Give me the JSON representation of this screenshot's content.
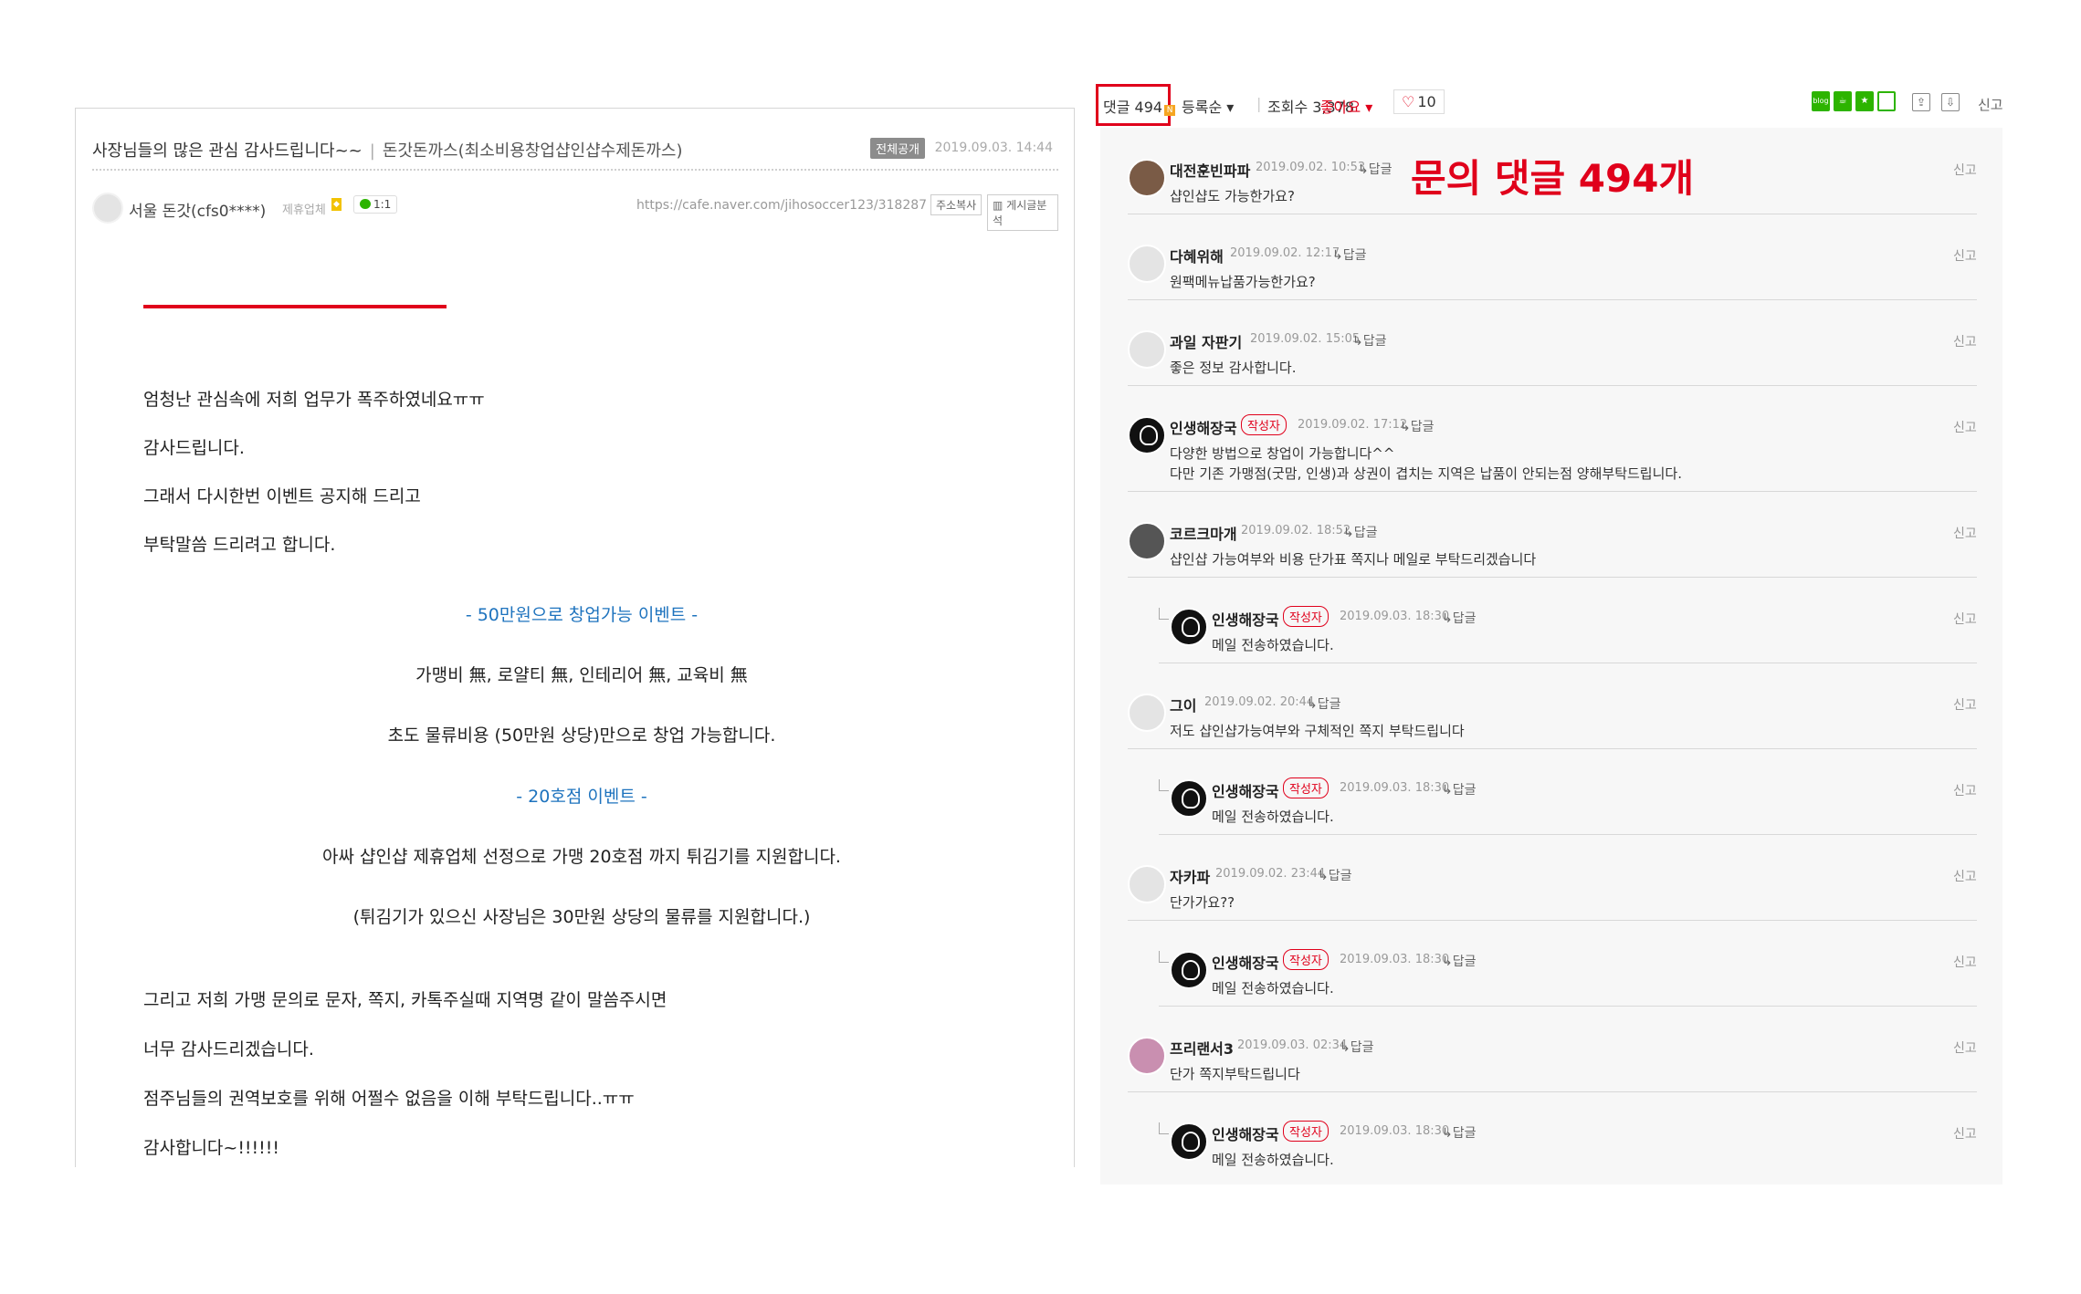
{
  "post": {
    "title": "사장님들의 많은 관심 감사드립니다~~",
    "separator": "|",
    "category": "돈갓돈까스(최소비용창업샵인샵수제돈까스)",
    "visibility_badge": "전체공개",
    "date": "2019.09.03. 14:44",
    "author_name": "서울 돈갓(cfs0****)",
    "author_grade": "제휴업체",
    "chat_count": "1:1",
    "url": "https://cafe.naver.com/jihosoccer123/318287",
    "copy_url_label": "주소복사",
    "analysis_label": "게시글분석",
    "body": {
      "l1": "엄청난 관심속에 저희 업무가 폭주하였네요ㅠㅠ",
      "l2": "감사드립니다.",
      "l3": "그래서 다시한번 이벤트 공지해 드리고",
      "l4": "부탁말씀 드리려고 합니다.",
      "l5": "- 50만원으로 창업가능 이벤트 -",
      "l6": "가맹비 無, 로얄티 無, 인테리어 無, 교육비 無",
      "l7": "초도 물류비용 (50만원 상당)만으로 창업 가능합니다.",
      "l8": "- 20호점 이벤트 -",
      "l9": "아싸 샵인샵 제휴업체 선정으로 가맹 20호점 까지 튀김기를 지원합니다.",
      "l10": "(튀김기가 있으신 사장님은 30만원 상당의 물류를 지원합니다.)",
      "l11": "그리고 저희 가맹 문의로 문자, 쪽지, 카톡주실때 지역명 같이 말씀주시면",
      "l12": "너무 감사드리겠습니다.",
      "l13": "점주님들의 권역보호를 위해 어쩔수 없음을 이해 부탁드립니다..ㅠㅠ",
      "l14": "감사합니다~!!!!!!"
    }
  },
  "comment_bar": {
    "count_label": "댓글 494",
    "new_mark": "N",
    "sort_label": "등록순 ▾",
    "views_label": "조회수 3,378",
    "like_label": "좋아요 ▾",
    "like_count": "10",
    "blog_icon": "blog",
    "report_label": "신고"
  },
  "callout": "문의 댓글 494개",
  "comments": [
    {
      "name": "대전훈빈파파",
      "date": "2019.09.02. 10:53",
      "reply": "↳답글",
      "text": "샵인샵도 가능한가요?",
      "report": "신고"
    },
    {
      "name": "다혜위해",
      "date": "2019.09.02. 12:17",
      "reply": "↳답글",
      "text": "원팩메뉴납품가능한가요?",
      "report": "신고"
    },
    {
      "name": "과일 자판기",
      "date": "2019.09.02. 15:05",
      "reply": "↳답글",
      "text": "좋은 정보 감사합니다.",
      "report": "신고"
    },
    {
      "name": "인생해장국",
      "tag": "작성자",
      "date": "2019.09.02. 17:12",
      "reply": "↳답글",
      "text": "다양한 방법으로 창업이 가능합니다^^",
      "text2": "다만 기존 가맹점(굿맘, 인생)과 상권이 겹치는 지역은 납품이 안되는점 양해부탁드립니다.",
      "report": "신고"
    },
    {
      "name": "코르크마개",
      "date": "2019.09.02. 18:52",
      "reply": "↳답글",
      "text": "샵인샵 가능여부와 비용 단가표 쪽지나 메일로 부탁드리겠습니다",
      "report": "신고"
    },
    {
      "name": "인생해장국",
      "tag": "작성자",
      "date": "2019.09.03. 18:30",
      "reply": "↳답글",
      "text": "메일 전송하였습니다.",
      "report": "신고"
    },
    {
      "name": "그이",
      "date": "2019.09.02. 20:44",
      "reply": "↳답글",
      "text": "저도 샵인샵가능여부와 구체적인 쪽지 부탁드립니다",
      "report": "신고"
    },
    {
      "name": "인생해장국",
      "tag": "작성자",
      "date": "2019.09.03. 18:30",
      "reply": "↳답글",
      "text": "메일 전송하였습니다.",
      "report": "신고"
    },
    {
      "name": "자카파",
      "date": "2019.09.02. 23:44",
      "reply": "↳답글",
      "text": "단가가요??",
      "report": "신고"
    },
    {
      "name": "인생해장국",
      "tag": "작성자",
      "date": "2019.09.03. 18:30",
      "reply": "↳답글",
      "text": "메일 전송하였습니다.",
      "report": "신고"
    },
    {
      "name": "프리랜서3",
      "date": "2019.09.03. 02:34",
      "reply": "↳답글",
      "text": "단가 쪽지부탁드립니다",
      "report": "신고"
    },
    {
      "name": "인생해장국",
      "tag": "작성자",
      "date": "2019.09.03. 18:30",
      "reply": "↳답글",
      "text": "메일 전송하였습니다.",
      "report": "신고"
    }
  ],
  "colors": {
    "accent_red": "#e0001b",
    "link_blue": "#1e73be",
    "naver_green": "#2db400"
  }
}
